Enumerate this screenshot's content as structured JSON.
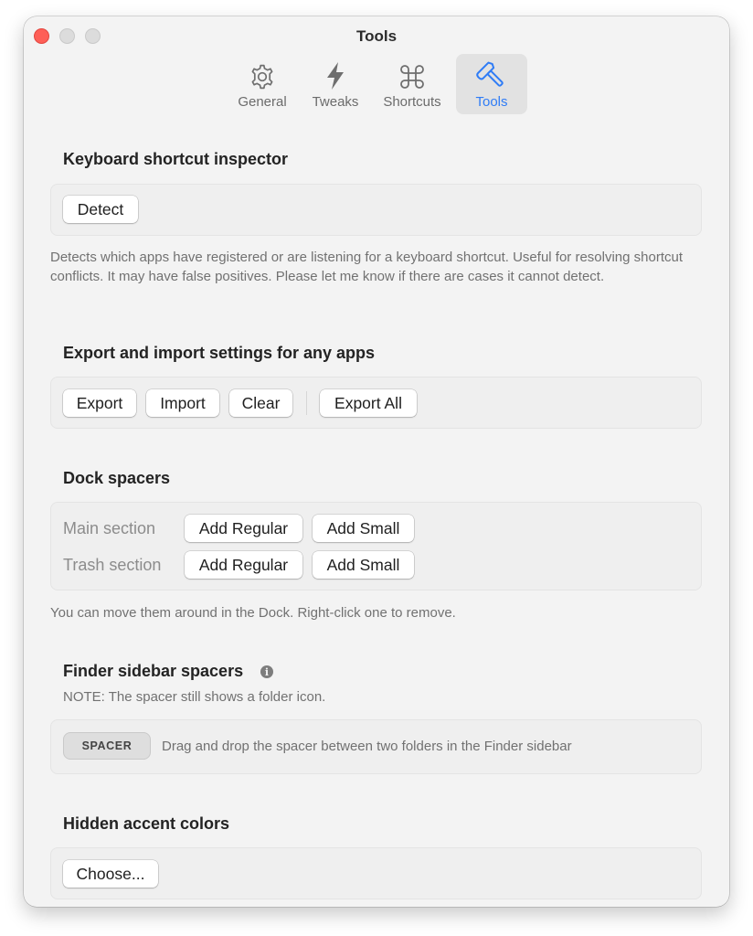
{
  "window": {
    "title": "Tools"
  },
  "tabs": [
    {
      "label": "General",
      "icon": "gear-icon"
    },
    {
      "label": "Tweaks",
      "icon": "lightning-bolt-icon"
    },
    {
      "label": "Shortcuts",
      "icon": "command-key-icon"
    },
    {
      "label": "Tools",
      "icon": "hammer-icon",
      "active": true
    }
  ],
  "accent_color": "#2f7cf6",
  "keyboard_inspector": {
    "title": "Keyboard shortcut inspector",
    "detect_label": "Detect",
    "description": "Detects which apps have registered or are listening for a keyboard shortcut. Useful for resolving shortcut conflicts. It may have false positives. Please let me know if there are cases it cannot detect."
  },
  "export_import": {
    "title": "Export and import settings for any apps",
    "export_label": "Export",
    "import_label": "Import",
    "clear_label": "Clear",
    "export_all_label": "Export All"
  },
  "dock_spacers": {
    "title": "Dock spacers",
    "main_label": "Main section",
    "trash_label": "Trash section",
    "add_regular_label": "Add Regular",
    "add_small_label": "Add Small",
    "description": "You can move them around in the Dock. Right-click one to remove."
  },
  "finder_spacers": {
    "title": "Finder sidebar spacers",
    "info_icon": "info-icon",
    "note": "NOTE: The spacer still shows a folder icon.",
    "spacer_label": "SPACER",
    "instruction": "Drag and drop the spacer between two folders in the Finder sidebar"
  },
  "accent_colors": {
    "title": "Hidden accent colors",
    "choose_label": "Choose..."
  }
}
